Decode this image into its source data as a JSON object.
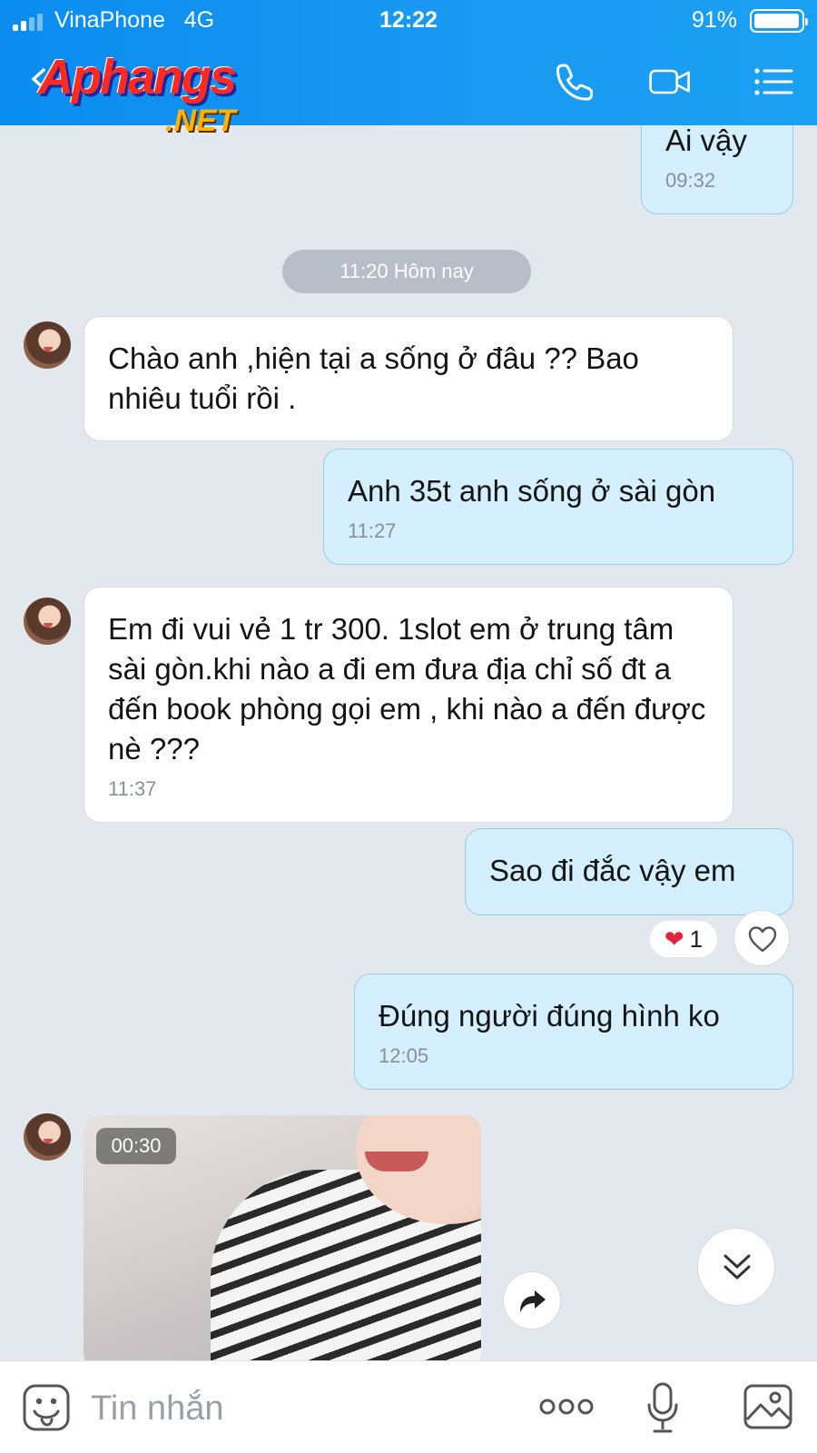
{
  "status_bar": {
    "carrier": "VinaPhone",
    "network": "4G",
    "time": "12:22",
    "battery_percent": "91%",
    "battery_level": 0.91
  },
  "header": {
    "logo_main": "Aphangs",
    "logo_sub": ".NET"
  },
  "chat": {
    "date_divider": "11:20 Hôm nay",
    "messages": [
      {
        "direction": "out",
        "text": "Ai vậy",
        "time": "09:32"
      },
      {
        "direction": "in",
        "text": "Chào anh ,hiện tại a sống ở đâu ?? Bao nhiêu tuổi rồi ."
      },
      {
        "direction": "out",
        "text": "Anh 35t anh sống ở sài gòn",
        "time": "11:27"
      },
      {
        "direction": "in",
        "text": "Em đi vui vẻ 1 tr 300. 1slot em ở trung tâm sài gòn.khi nào a đi em đưa địa chỉ số đt a đến book phòng gọi em , khi nào a đến được nè ???",
        "time": "11:37"
      },
      {
        "direction": "out",
        "text": "Sao đi đắc vậy em",
        "reaction_count": "1"
      },
      {
        "direction": "out",
        "text": "Đúng người đúng hình ko",
        "time": "12:05"
      },
      {
        "direction": "in",
        "type": "video",
        "duration": "00:30"
      }
    ]
  },
  "input_bar": {
    "placeholder": "Tin nhắn"
  },
  "icons": {
    "back": "chevron-left-icon",
    "call": "phone-icon",
    "video": "video-camera-icon",
    "menu": "list-menu-icon",
    "sticker": "emoji-icon",
    "more": "more-dots-icon",
    "mic": "microphone-icon",
    "image": "image-icon"
  },
  "colors": {
    "header": "#1a9af2",
    "outgoing_bubble": "#d4efff",
    "incoming_bubble": "#ffffff",
    "background": "#e3e8ef"
  }
}
